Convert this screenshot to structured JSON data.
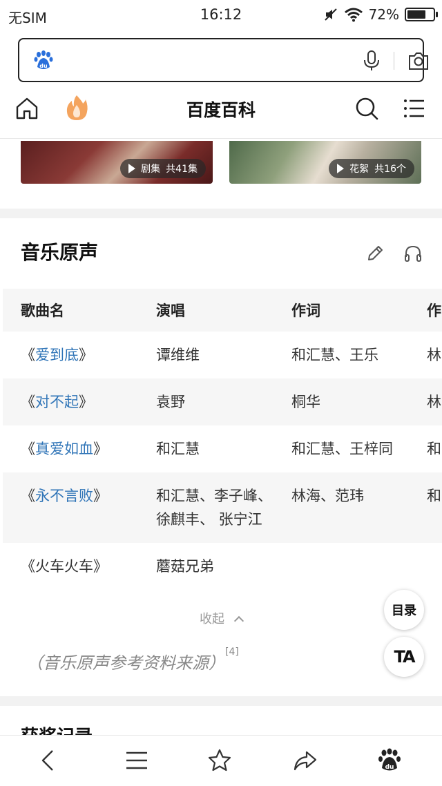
{
  "status_bar": {
    "carrier": "无SIM",
    "time": "16:12",
    "battery": "72%",
    "battery_level": 0.72
  },
  "search": {
    "logo_icon": "baidu-paw-icon",
    "mic_icon": "microphone-icon",
    "camera_icon": "camera-icon"
  },
  "nav": {
    "title": "百度百科",
    "home_icon": "home-icon",
    "hot_icon": "flame-icon",
    "search_icon": "search-icon",
    "menu_icon": "menu-icon"
  },
  "videos": [
    {
      "type": "剧集",
      "count": "共41集"
    },
    {
      "type": "花絮",
      "count": "共16个"
    }
  ],
  "music_section": {
    "title": "音乐原声",
    "headers": [
      "歌曲名",
      "演唱",
      "作词",
      "作"
    ],
    "rows": [
      {
        "song": "爱到底",
        "singer": "谭维维",
        "lyricist": "和汇慧、王乐",
        "composer": "林"
      },
      {
        "song": "对不起",
        "singer": "袁野",
        "lyricist": "桐华",
        "composer": "林"
      },
      {
        "song": "真爱如血",
        "singer": "和汇慧",
        "lyricist": "和汇慧、王梓同",
        "composer": "和"
      },
      {
        "song": "永不言败",
        "singer": "和汇慧、李子峰、徐麒丰、 张宁江",
        "lyricist": "林海、范玮",
        "composer": "和"
      },
      {
        "song": "火车火车",
        "singer": "蘑菇兄弟",
        "lyricist": "",
        "composer": ""
      }
    ],
    "collapse_label": "收起",
    "reference_text": "（音乐原声参考资料来源）",
    "reference_mark": "[4]"
  },
  "float_buttons": {
    "toc": "目录",
    "ta": "TA"
  },
  "next_section_title": "获奖记录",
  "colors": {
    "link": "#2f74b7",
    "baidu_blue": "#2a6fdb",
    "flame": "#f39a4c"
  }
}
